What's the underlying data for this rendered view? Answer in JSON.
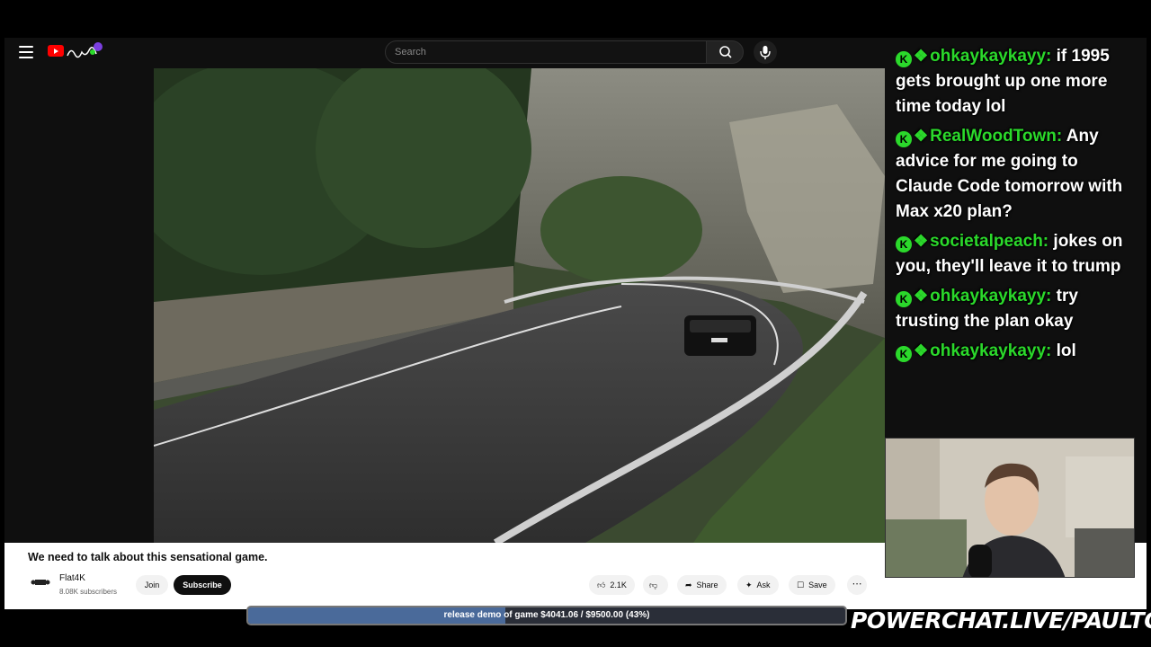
{
  "search": {
    "placeholder": "Search"
  },
  "video": {
    "title": "We need to talk about this sensational game.",
    "channel": "Flat4K",
    "subscribers": "8.08K subscribers",
    "join_label": "Join",
    "subscribe_label": "Subscribe",
    "likes": "2.1K",
    "share_label": "Share",
    "ask_label": "Ask",
    "save_label": "Save"
  },
  "chat": [
    {
      "user": "ohkaykaykayy:",
      "text": "if 1995 gets brought up one more time today lol"
    },
    {
      "user": "RealWoodTown:",
      "text": "Any advice for me going to Claude Code tomorrow with Max x20 plan?"
    },
    {
      "user": "societalpeach:",
      "text": "jokes on you, they'll leave it to trump"
    },
    {
      "user": "ohkaykaykayy:",
      "text": "try trusting the plan okay"
    },
    {
      "user": "ohkaykaykayy:",
      "text": "lol"
    }
  ],
  "goal": {
    "label": "release demo of game $4041.06 / $9500.00 (43%)",
    "progress": 0.43
  },
  "overlay": {
    "url": "POWERCHAT.LIVE/PAULTOWN"
  },
  "colors": {
    "chat_user": "#2bd92b",
    "subscribe_bg": "#0f0f0f",
    "goal_fill": "#4a6a9a"
  }
}
